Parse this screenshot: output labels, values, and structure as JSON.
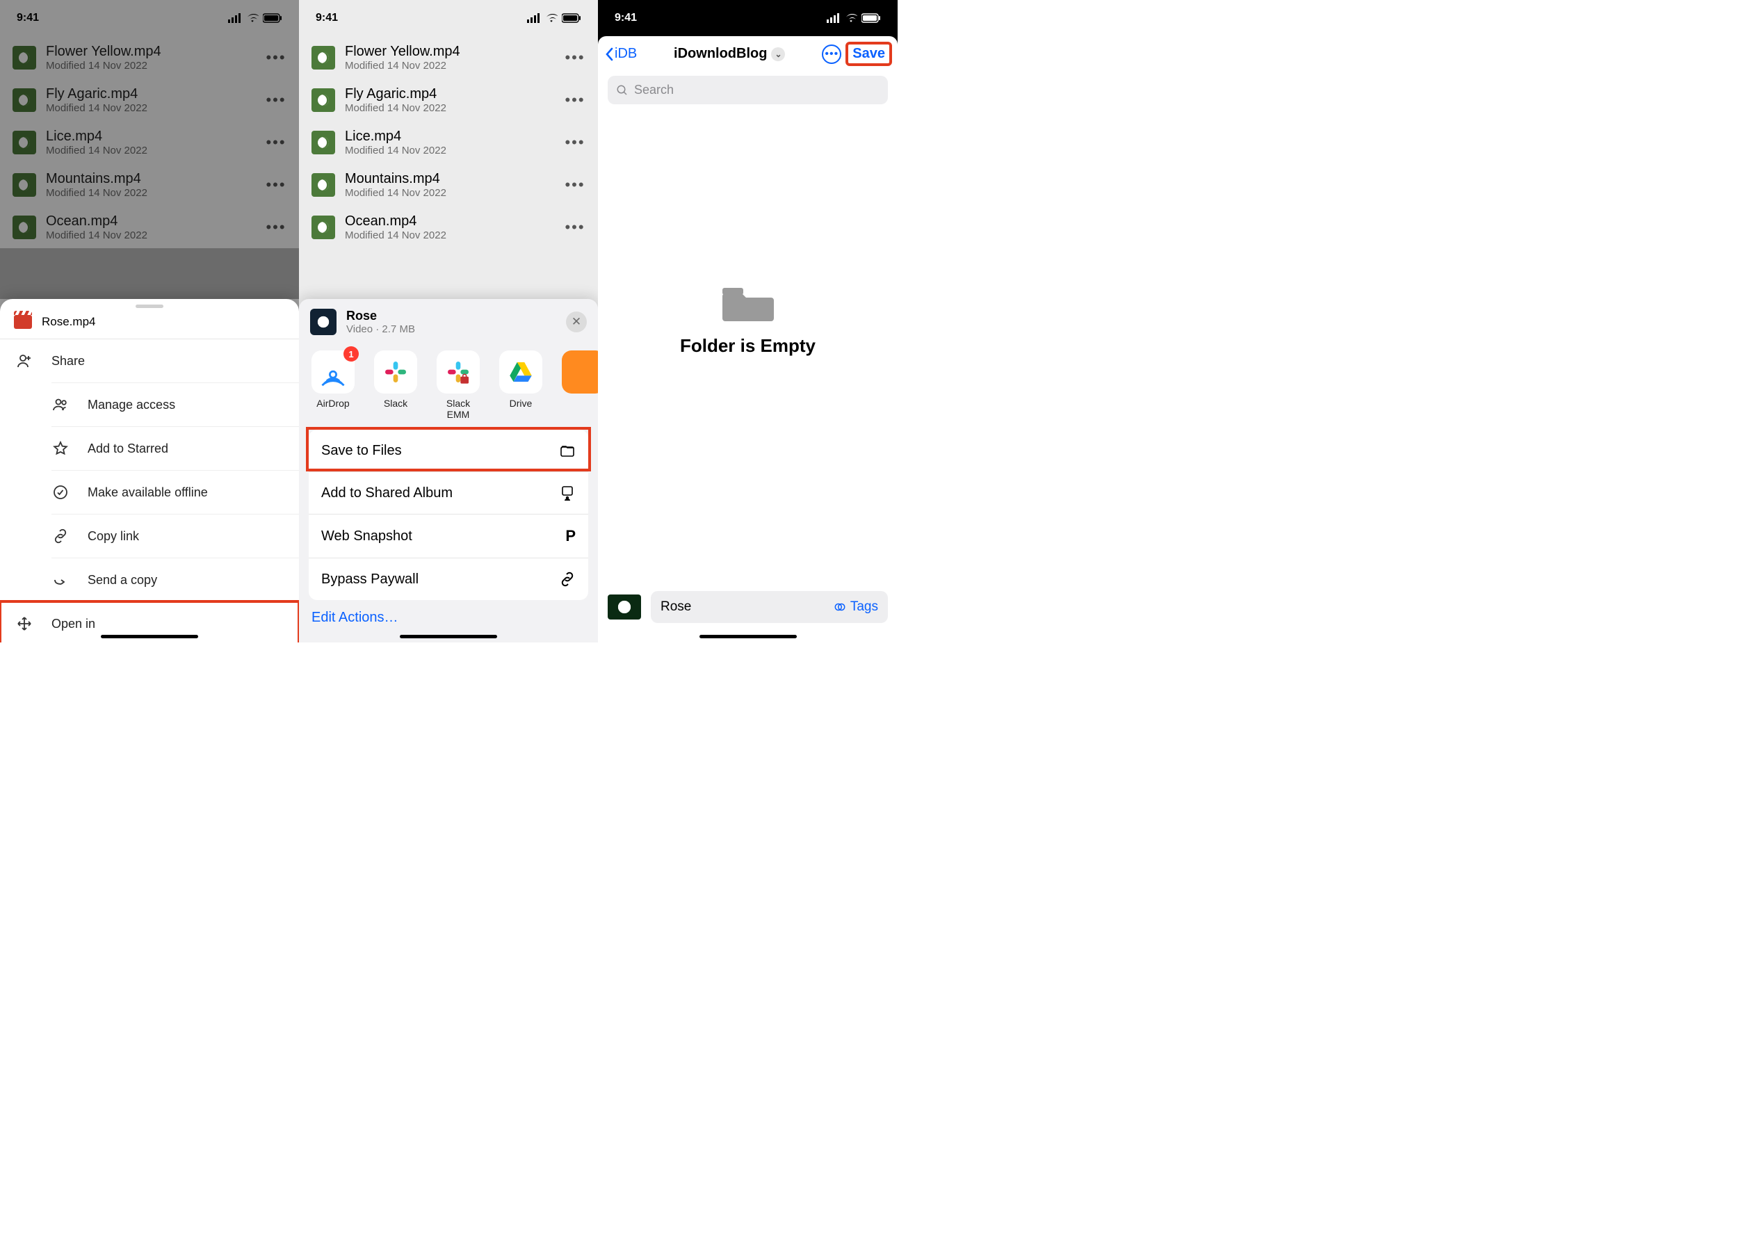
{
  "status": {
    "time": "9:41"
  },
  "files": [
    {
      "name": "Flower Yellow.mp4",
      "modified": "Modified 14 Nov 2022"
    },
    {
      "name": "Fly Agaric.mp4",
      "modified": "Modified 14 Nov 2022"
    },
    {
      "name": "Lice.mp4",
      "modified": "Modified 14 Nov 2022"
    },
    {
      "name": "Mountains.mp4",
      "modified": "Modified 14 Nov 2022"
    },
    {
      "name": "Ocean.mp4",
      "modified": "Modified 14 Nov 2022"
    }
  ],
  "drive_sheet": {
    "file": "Rose.mp4",
    "items": [
      {
        "id": "share",
        "label": "Share"
      },
      {
        "id": "access",
        "label": "Manage access"
      },
      {
        "id": "star",
        "label": "Add to Starred"
      },
      {
        "id": "offline",
        "label": "Make available offline"
      },
      {
        "id": "copy",
        "label": "Copy link"
      },
      {
        "id": "send",
        "label": "Send a copy"
      },
      {
        "id": "openin",
        "label": "Open in"
      }
    ]
  },
  "share_sheet": {
    "title": "Rose",
    "subtitle": "Video · 2.7 MB",
    "apps": [
      {
        "id": "airdrop",
        "label": "AirDrop",
        "badge": "1"
      },
      {
        "id": "slack",
        "label": "Slack"
      },
      {
        "id": "slackemm",
        "label": "Slack EMM"
      },
      {
        "id": "drive",
        "label": "Drive"
      }
    ],
    "actions": [
      {
        "id": "savefiles",
        "label": "Save to Files"
      },
      {
        "id": "album",
        "label": "Add to Shared Album"
      },
      {
        "id": "websnap",
        "label": "Web Snapshot"
      },
      {
        "id": "bypass",
        "label": "Bypass Paywall"
      }
    ],
    "edit": "Edit Actions…"
  },
  "files_picker": {
    "back": "iDB",
    "title": "iDownlodBlog",
    "save": "Save",
    "search_placeholder": "Search",
    "empty_title": "Folder is Empty",
    "filename": "Rose",
    "tags": "Tags"
  }
}
